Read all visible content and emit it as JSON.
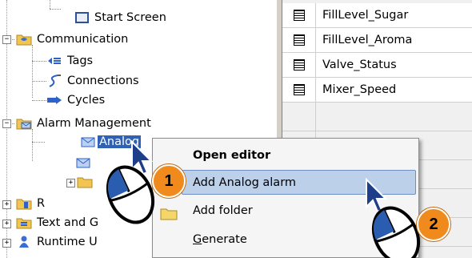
{
  "tree": {
    "items": [
      {
        "label": "Start Screen",
        "icon": "start-screen-icon"
      },
      {
        "label": "Communication",
        "icon": "communication-folder-icon"
      },
      {
        "label": "Tags",
        "icon": "tags-icon"
      },
      {
        "label": "Connections",
        "icon": "connections-icon"
      },
      {
        "label": "Cycles",
        "icon": "cycles-icon"
      },
      {
        "label": "Alarm Management",
        "icon": "alarm-management-folder-icon"
      },
      {
        "label": "Analog",
        "icon": "analog-alarms-icon",
        "selected": true
      },
      {
        "label": "R",
        "icon": "folder-icon"
      },
      {
        "label": "Text and G",
        "icon": "folder-icon"
      },
      {
        "label": "Runtime U",
        "icon": "runtime-user-icon"
      }
    ],
    "selection_color": "#2f62b4"
  },
  "table": {
    "rows": [
      "FillLevel_Sugar",
      "FillLevel_Aroma",
      "Valve_Status",
      "Mixer_Speed"
    ]
  },
  "context_menu": {
    "items": [
      {
        "label": "Open editor",
        "bold": true
      },
      {
        "label": "Add Analog alarm",
        "highlighted": true
      },
      {
        "label": "Add folder",
        "icon": "folder-icon"
      },
      {
        "label": "Generate",
        "mnemonic": "G"
      }
    ],
    "highlight_color": "#bcd0ea"
  },
  "steps": [
    {
      "number": "1"
    },
    {
      "number": "2"
    }
  ],
  "badge_color": "#f08a1c"
}
